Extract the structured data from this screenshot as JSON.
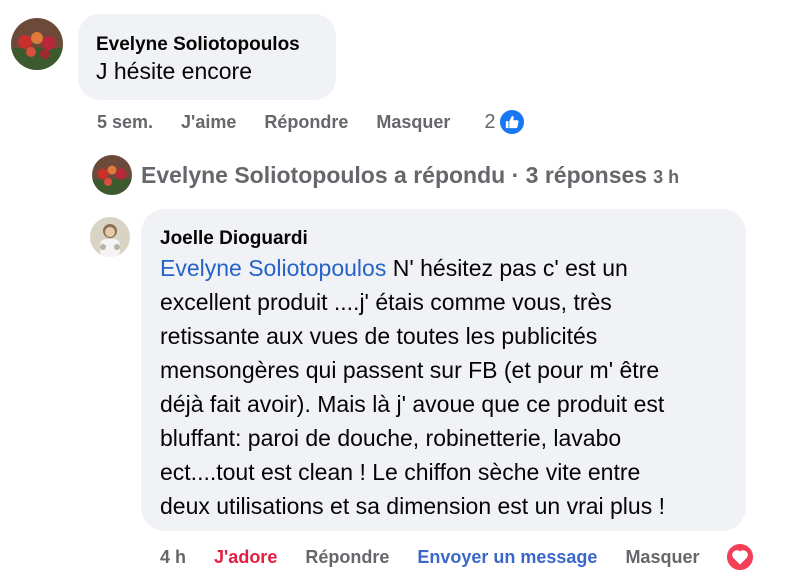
{
  "comment": {
    "author": "Evelyne Soliotopoulos",
    "text": "J hésite encore",
    "actions": {
      "time": "5 sem.",
      "like": "J'aime",
      "reply": "Répondre",
      "hide": "Masquer",
      "reaction_count": "2"
    }
  },
  "replies_summary": {
    "text": "Evelyne Soliotopoulos a répondu · 3 réponses",
    "time": "3 h"
  },
  "reply": {
    "author": "Joelle Dioguardi",
    "mention": "Evelyne Soliotopoulos",
    "lines": [
      " N' hésitez pas c' est un",
      "excellent produit ....j' étais comme vous, très",
      "retissante aux vues de toutes les publicités",
      "mensongères qui passent sur FB (et pour m' être",
      "déjà fait avoir). Mais là j' avoue que ce produit est",
      "bluffant: paroi de douche, robinetterie, lavabo",
      "ect....tout est clean ! Le chiffon sèche vite entre",
      "deux utilisations et sa dimension est un vrai plus !"
    ],
    "actions": {
      "time": "4 h",
      "love": "J'adore",
      "reply": "Répondre",
      "message": "Envoyer un message",
      "hide": "Masquer"
    }
  },
  "colors": {
    "bubble": "#f0f2f5",
    "secondary_text": "#65676b",
    "mention": "#2563c9",
    "love": "#e41e3f",
    "like": "#1877f2"
  }
}
